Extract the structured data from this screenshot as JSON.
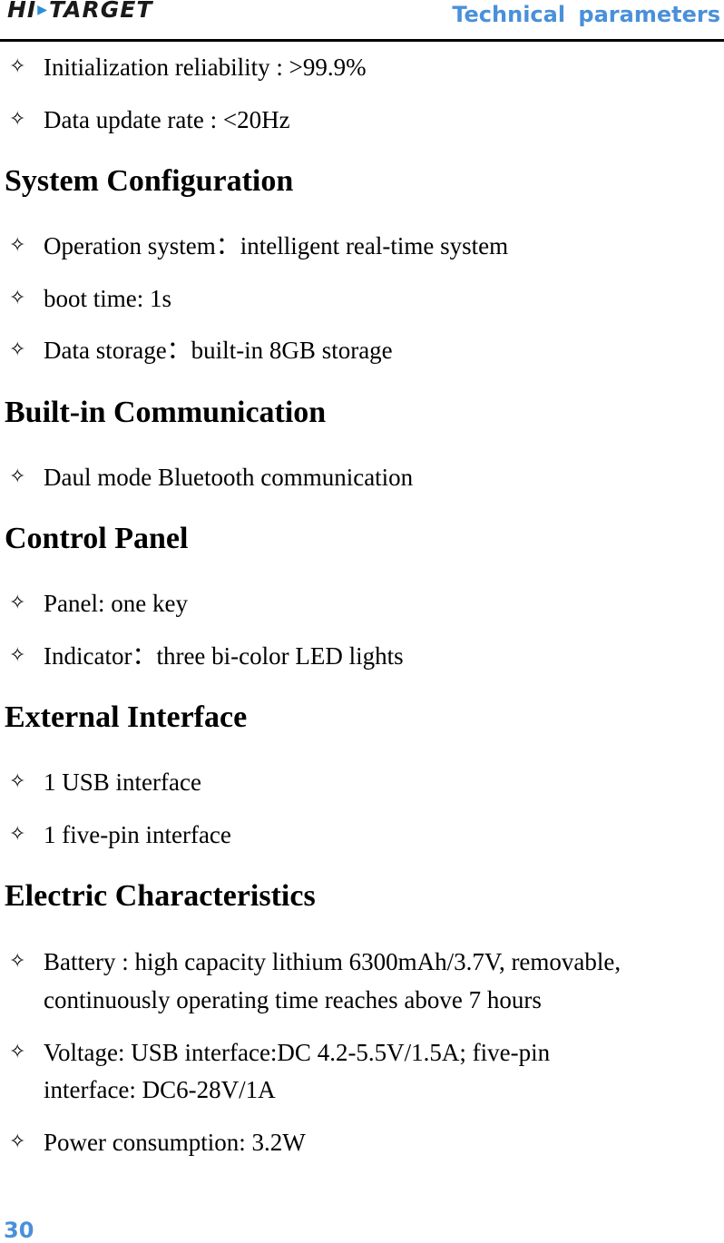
{
  "header": {
    "logo_text_left": "HI",
    "logo_text_right": "TARGET",
    "title": "Technical parameters"
  },
  "items_top": [
    {
      "text": "Initialization reliability : >99.9%"
    },
    {
      "text": "Data update rate : <20Hz"
    }
  ],
  "sections": [
    {
      "heading": "System Configuration",
      "items": [
        {
          "text": "Operation system：intelligent real-time system"
        },
        {
          "text": "boot time: 1s"
        },
        {
          "text": "Data storage：built-in 8GB storage"
        }
      ]
    },
    {
      "heading": "Built-in Communication",
      "items": [
        {
          "text": "Daul mode Bluetooth communication"
        }
      ]
    },
    {
      "heading": "Control Panel",
      "items": [
        {
          "text": "Panel: one key"
        },
        {
          "text": "Indicator：three bi-color LED lights"
        }
      ]
    },
    {
      "heading": "External Interface",
      "items": [
        {
          "text": "1 USB interface"
        },
        {
          "text": "1 five-pin interface"
        }
      ]
    },
    {
      "heading": "Electric Characteristics",
      "items": [
        {
          "line1": "Battery : high capacity lithium 6300mAh/3.7V, removable,",
          "line2": "continuously operating time reaches above 7 hours"
        },
        {
          "line1": "Voltage: USB interface:DC 4.2-5.5V/1.5A; five-pin",
          "line2": "interface: DC6-28V/1A"
        },
        {
          "text": "Power consumption: 3.2W"
        }
      ]
    }
  ],
  "bullet_icon": "four-point-star-outline",
  "bullet_glyph": "✧",
  "page_number": "30"
}
